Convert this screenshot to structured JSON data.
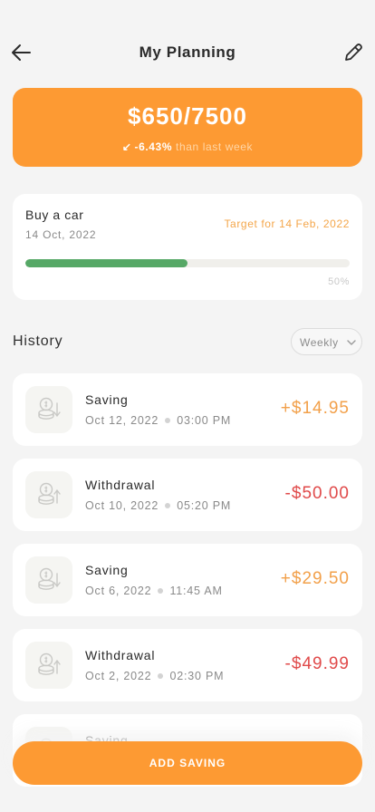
{
  "header": {
    "title": "My Planning",
    "back_icon": "arrow-left-icon",
    "edit_icon": "pencil-icon"
  },
  "balance": {
    "amount": "$650/7500",
    "change_arrow": "↙",
    "change_pct": "-6.43%",
    "change_suffix": "than last week"
  },
  "goal": {
    "name": "Buy a car",
    "start_date": "14 Oct, 2022",
    "target": "Target for 14 Feb, 2022",
    "progress_value": 0.5,
    "progress_label": "50%"
  },
  "history": {
    "title": "History",
    "period": "Weekly",
    "transactions": [
      {
        "type": "Saving",
        "date": "Oct 12, 2022",
        "time": "03:00 PM",
        "amount": "+$14.95",
        "kind": "saving"
      },
      {
        "type": "Withdrawal",
        "date": "Oct 10, 2022",
        "time": "05:20 PM",
        "amount": "-$50.00",
        "kind": "withdrawal"
      },
      {
        "type": "Saving",
        "date": "Oct 6, 2022",
        "time": "11:45 AM",
        "amount": "+$29.50",
        "kind": "saving"
      },
      {
        "type": "Withdrawal",
        "date": "Oct 2, 2022",
        "time": "02:30 PM",
        "amount": "-$49.99",
        "kind": "withdrawal"
      },
      {
        "type": "Saving",
        "date": "",
        "time": "",
        "amount": "",
        "kind": "saving"
      }
    ]
  },
  "actions": {
    "add_saving": "ADD SAVING"
  },
  "colors": {
    "accent": "#fd9a33",
    "positive": "#f2a04a",
    "negative": "#e04a4a",
    "progress": "#56a866"
  }
}
